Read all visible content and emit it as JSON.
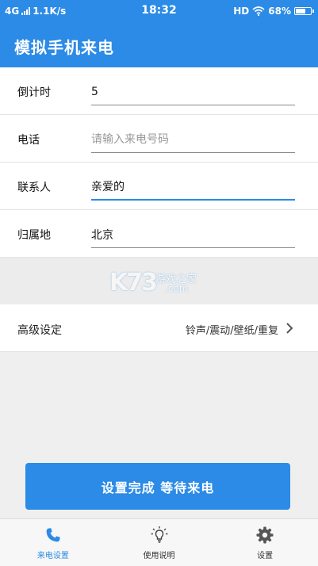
{
  "status_bar": {
    "network": "4G",
    "speed": "1.1K/s",
    "time": "18:32",
    "hd": "HD",
    "battery": "68%",
    "battery_level": 0.68
  },
  "app": {
    "title": "模拟手机来电"
  },
  "form": {
    "countdown": {
      "label": "倒计时",
      "value": "5"
    },
    "phone": {
      "label": "电话",
      "value": "",
      "placeholder": "请输入来电号码"
    },
    "contact": {
      "label": "联系人",
      "value": "亲爱的"
    },
    "location": {
      "label": "归属地",
      "value": "北京"
    }
  },
  "watermark": {
    "big": "K73",
    "cn": "游戏之家",
    "com": ".com"
  },
  "advanced": {
    "label": "高级设定",
    "value": "铃声/震动/壁纸/重复"
  },
  "submit": {
    "label": "设置完成 等待来电"
  },
  "tabs": [
    {
      "label": "来电设置",
      "icon": "phone-icon",
      "active": true
    },
    {
      "label": "使用说明",
      "icon": "lightbulb-icon",
      "active": false
    },
    {
      "label": "设置",
      "icon": "gear-icon",
      "active": false
    }
  ],
  "colors": {
    "accent": "#2b8be6",
    "background": "#efefef"
  }
}
